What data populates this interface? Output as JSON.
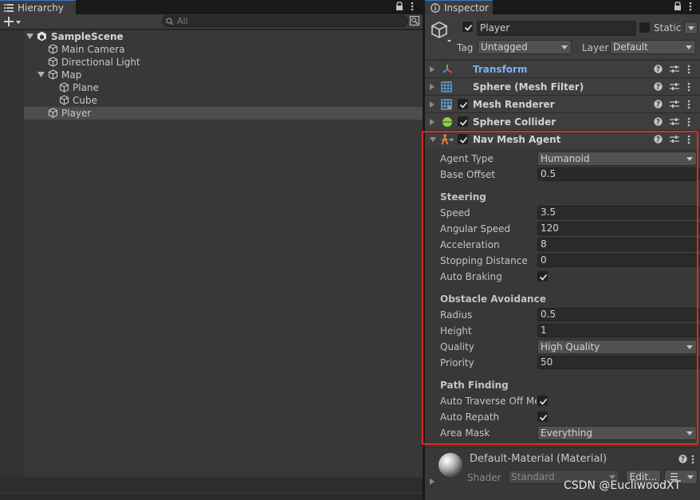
{
  "hierarchy": {
    "tab_title": "Hierarchy",
    "search_placeholder": "All",
    "rows": [
      {
        "label": "SampleScene"
      },
      {
        "label": "Main Camera"
      },
      {
        "label": "Directional Light"
      },
      {
        "label": "Map"
      },
      {
        "label": "Plane"
      },
      {
        "label": "Cube"
      },
      {
        "label": "Player"
      }
    ]
  },
  "inspector": {
    "tab_title": "Inspector",
    "object_name": "Player",
    "static_label": "Static",
    "tag_label": "Tag",
    "tag_value": "Untagged",
    "layer_label": "Layer",
    "layer_value": "Default",
    "components": [
      {
        "title": "Transform",
        "color": "#7fb2f0"
      },
      {
        "title": "Sphere (Mesh Filter)"
      },
      {
        "title": "Mesh Renderer"
      },
      {
        "title": "Sphere Collider"
      },
      {
        "title": "Nav Mesh Agent"
      }
    ],
    "nav": {
      "agent_type_label": "Agent Type",
      "agent_type_value": "Humanoid",
      "base_offset_label": "Base Offset",
      "base_offset_value": "0.5",
      "steering_header": "Steering",
      "speed_label": "Speed",
      "speed_value": "3.5",
      "angular_speed_label": "Angular Speed",
      "angular_speed_value": "120",
      "acceleration_label": "Acceleration",
      "acceleration_value": "8",
      "stopping_distance_label": "Stopping Distance",
      "stopping_distance_value": "0",
      "auto_braking_label": "Auto Braking",
      "obstacle_header": "Obstacle Avoidance",
      "radius_label": "Radius",
      "radius_value": "0.5",
      "height_label": "Height",
      "height_value": "1",
      "quality_label": "Quality",
      "quality_value": "High Quality",
      "priority_label": "Priority",
      "priority_value": "50",
      "path_header": "Path Finding",
      "auto_traverse_label": "Auto Traverse Off Me",
      "auto_repath_label": "Auto Repath",
      "area_mask_label": "Area Mask",
      "area_mask_value": "Everything"
    },
    "material": {
      "title": "Default-Material (Material)",
      "shader_label": "Shader",
      "shader_value": "Standard",
      "edit_label": "Edit...",
      "list_icon": "☰"
    }
  },
  "watermark": "CSDN @EucliwoodXT",
  "colors": {
    "highlight_box": "#e02b20",
    "accent": "#3a79bb"
  }
}
